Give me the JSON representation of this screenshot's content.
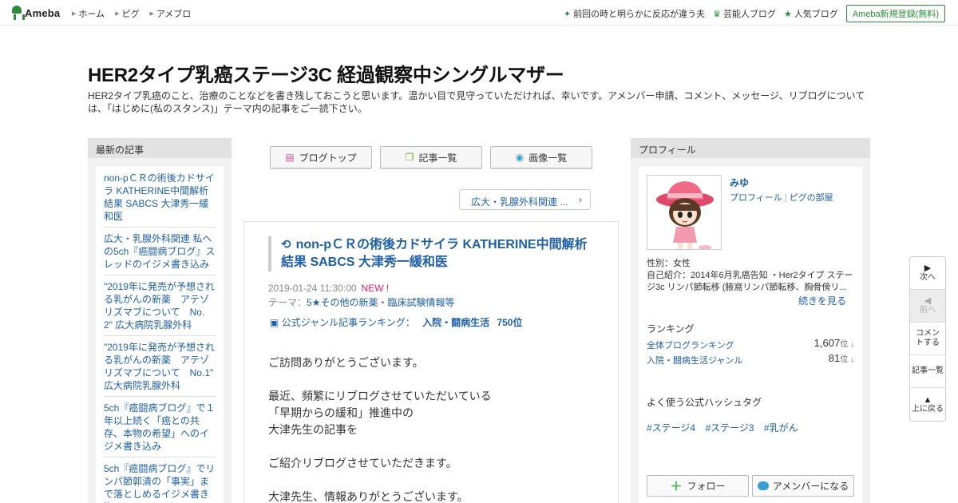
{
  "topbar": {
    "logo": "Ameba",
    "nav": [
      "ホーム",
      "ピグ",
      "アメブロ"
    ],
    "right": [
      {
        "icon": "sparkle-icon",
        "label": "前回の時と明らかに反応が違う夫"
      },
      {
        "icon": "crown-icon",
        "label": "芸能人ブログ"
      },
      {
        "icon": "star-icon",
        "label": "人気ブログ"
      }
    ],
    "register": "Ameba新規登録(無料)"
  },
  "header": {
    "title": "HER2タイプ乳癌ステージ3C 経過観察中シングルマザー",
    "description": "HER2タイプ乳癌のこと、治療のことなどを書き残しておこうと思います。温かい目で見守っていただければ、幸いです。アメンバー申請、コメント、メッセージ、リブログについては、「はじめに(私のスタンス)」テーマ内の記事をご一読下さい。"
  },
  "recent": {
    "heading": "最新の記事",
    "items": [
      "non-pＣＲの術後カドサイラ KATHERINE中間解析結果 SABCS 大津秀一緩和医",
      "広大・乳腺外科関連 私への5ch『癌闘病ブログ』スレッドのイジメ書き込み",
      "\"2019年に発売が予想される乳がんの新薬　アテゾリズマブについて　No. 2\" 広大病院乳腺外科",
      "\"2019年に発売が予想される乳がんの新薬　アテゾリズマブについて　No.1\" 広大病院乳腺外科",
      "5ch『癌闘病ブログ』で１年以上続く「癌との共存、本物の希望」へのイジメ書き込み",
      "5ch『癌闘病ブログ』でリンパ節郭清の「事実」まで落としめるイジメ書き込み"
    ]
  },
  "tools": {
    "top": "ブログトップ",
    "list": "記事一覧",
    "images": "画像一覧",
    "theme_pill": "広大・乳腺外科関連 ..."
  },
  "article": {
    "title": "non-pＣＲの術後カドサイラ KATHERINE中間解析結果 SABCS 大津秀一緩和医",
    "date": "2019-01-24 11:30:00",
    "new_label": "NEW !",
    "theme_label": "テーマ：",
    "theme": "5★その他の新薬・臨床試験情報等",
    "ranking_label": "公式ジャンル記事ランキング：",
    "ranking_genre": "入院・闘病生活",
    "ranking_value": "750位",
    "body": [
      "ご訪問ありがとうございます。",
      "",
      "最近、頻繁にリブログさせていただいている",
      "「早期からの緩和」推進中の",
      "大津先生の記事を",
      "",
      "ご紹介リブログさせていただきます。",
      "",
      "大津先生、情報ありがとうございます。"
    ]
  },
  "profile": {
    "heading": "プロフィール",
    "name": "みゆ",
    "link_profile": "プロフィール",
    "link_pig": "ピグの部屋",
    "gender": "性別：女性",
    "intro": "自己紹介：2014年6月乳癌告知 ・Her2タイプ ステージ3c リンパ節転移 (腋窩リンパ節転移、胸骨傍リ...",
    "more": "続きを見る",
    "ranking_heading": "ランキング",
    "rankings": [
      {
        "label": "全体ブログランキング",
        "value": "1,607",
        "unit": "位 ↓"
      },
      {
        "label": "入院・闘病生活ジャンル",
        "value": "81",
        "unit": "位 ↓"
      }
    ],
    "hashtag_heading": "よく使う公式ハッシュタグ",
    "hashtags": [
      "#ステージ4",
      "#ステージ3",
      "#乳がん"
    ],
    "follow": "フォロー",
    "amember": "アメンバーになる"
  },
  "sidenav": {
    "next": "次へ",
    "prev": "前へ",
    "comment": "コメントする",
    "list": "記事一覧",
    "top": "上に戻る"
  },
  "colors": {
    "brand": "#2d8c3c",
    "link": "#1e5fa6",
    "new": "#e0226a"
  }
}
